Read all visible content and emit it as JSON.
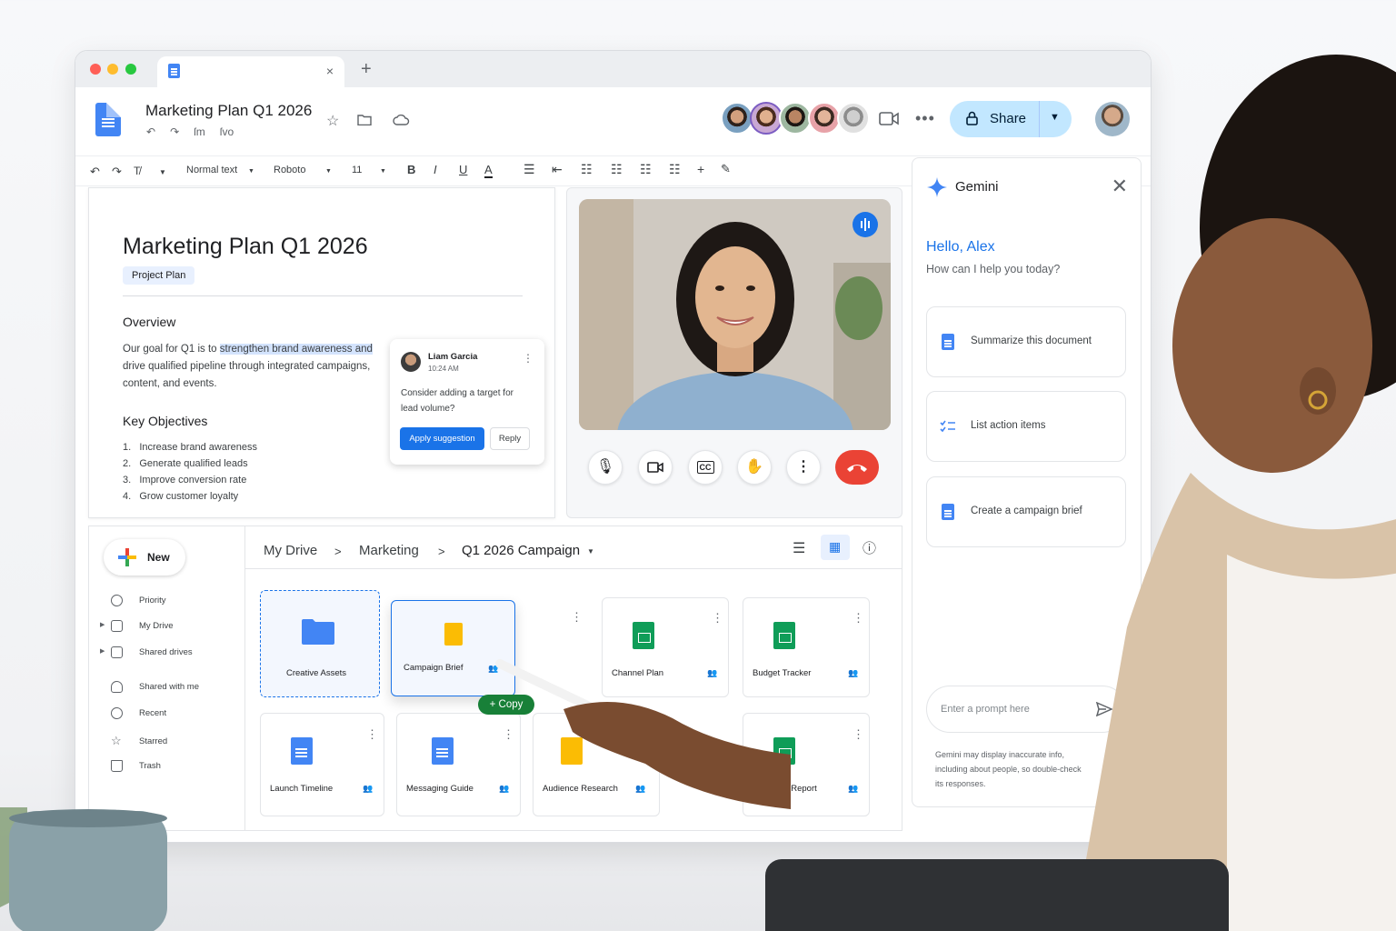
{
  "browser": {
    "tab_close": "×",
    "new_tab": "+"
  },
  "doc": {
    "title": "Marketing Plan Q1 2026",
    "menu": [
      "ſm",
      "ſvo"
    ],
    "share_label": "Share"
  },
  "toolbar": {
    "style": "Normal text",
    "font": "Roboto",
    "size": "11"
  },
  "document": {
    "heading": "Marketing Plan Q1 2026",
    "chip": "Project Plan",
    "overview_heading": "Overview",
    "overview_pre": "Our goal for Q1 is to ",
    "overview_highlight": "strengthen brand awareness and",
    "overview_post": "drive qualified pipeline through integrated campaigns, content, and events.",
    "objectives_heading": "Key Objectives",
    "objectives": [
      "Increase brand awareness",
      "Generate qualified leads",
      "Improve conversion rate",
      "Grow customer loyalty"
    ]
  },
  "comment": {
    "author": "Liam Garcia",
    "time": "10:24 AM",
    "text": "Consider adding a target for lead volume?",
    "apply": "Apply suggestion",
    "reply": "Reply"
  },
  "gemini": {
    "title": "Gemini",
    "hello": "Hello, Alex",
    "ask": "How can I help you today?",
    "suggestions": [
      "Summarize this document",
      "List action items",
      "Create a campaign brief"
    ],
    "placeholder": "Enter a prompt here",
    "disclaimer": "Gemini may display inaccurate info, including about people, so double-check its responses."
  },
  "drive": {
    "new_label": "New",
    "nav": [
      "Priority",
      "My Drive",
      "Shared drives",
      "Shared with me",
      "Recent",
      "Starred",
      "Trash"
    ],
    "breadcrumb": [
      "My Drive",
      "Marketing",
      "Q1 2026 Campaign"
    ],
    "files": [
      {
        "name": "Creative Assets",
        "type": "folder"
      },
      {
        "name": "Campaign Brief",
        "type": "slides"
      },
      {
        "name": "Channel Plan",
        "type": "sheet"
      },
      {
        "name": "Budget Tracker",
        "type": "sheet"
      },
      {
        "name": "Launch Timeline",
        "type": "doc"
      },
      {
        "name": "Messaging Guide",
        "type": "doc"
      },
      {
        "name": "Audience Research",
        "type": "slides"
      },
      {
        "name": "formance Report",
        "type": "sheet"
      }
    ],
    "copy_label": "+ Copy"
  },
  "colors": {
    "accent": "#1a73e8",
    "share_bg": "#c2e7ff",
    "hangup": "#ea4335",
    "sheets": "#0f9d58",
    "slides": "#fbbc04"
  }
}
